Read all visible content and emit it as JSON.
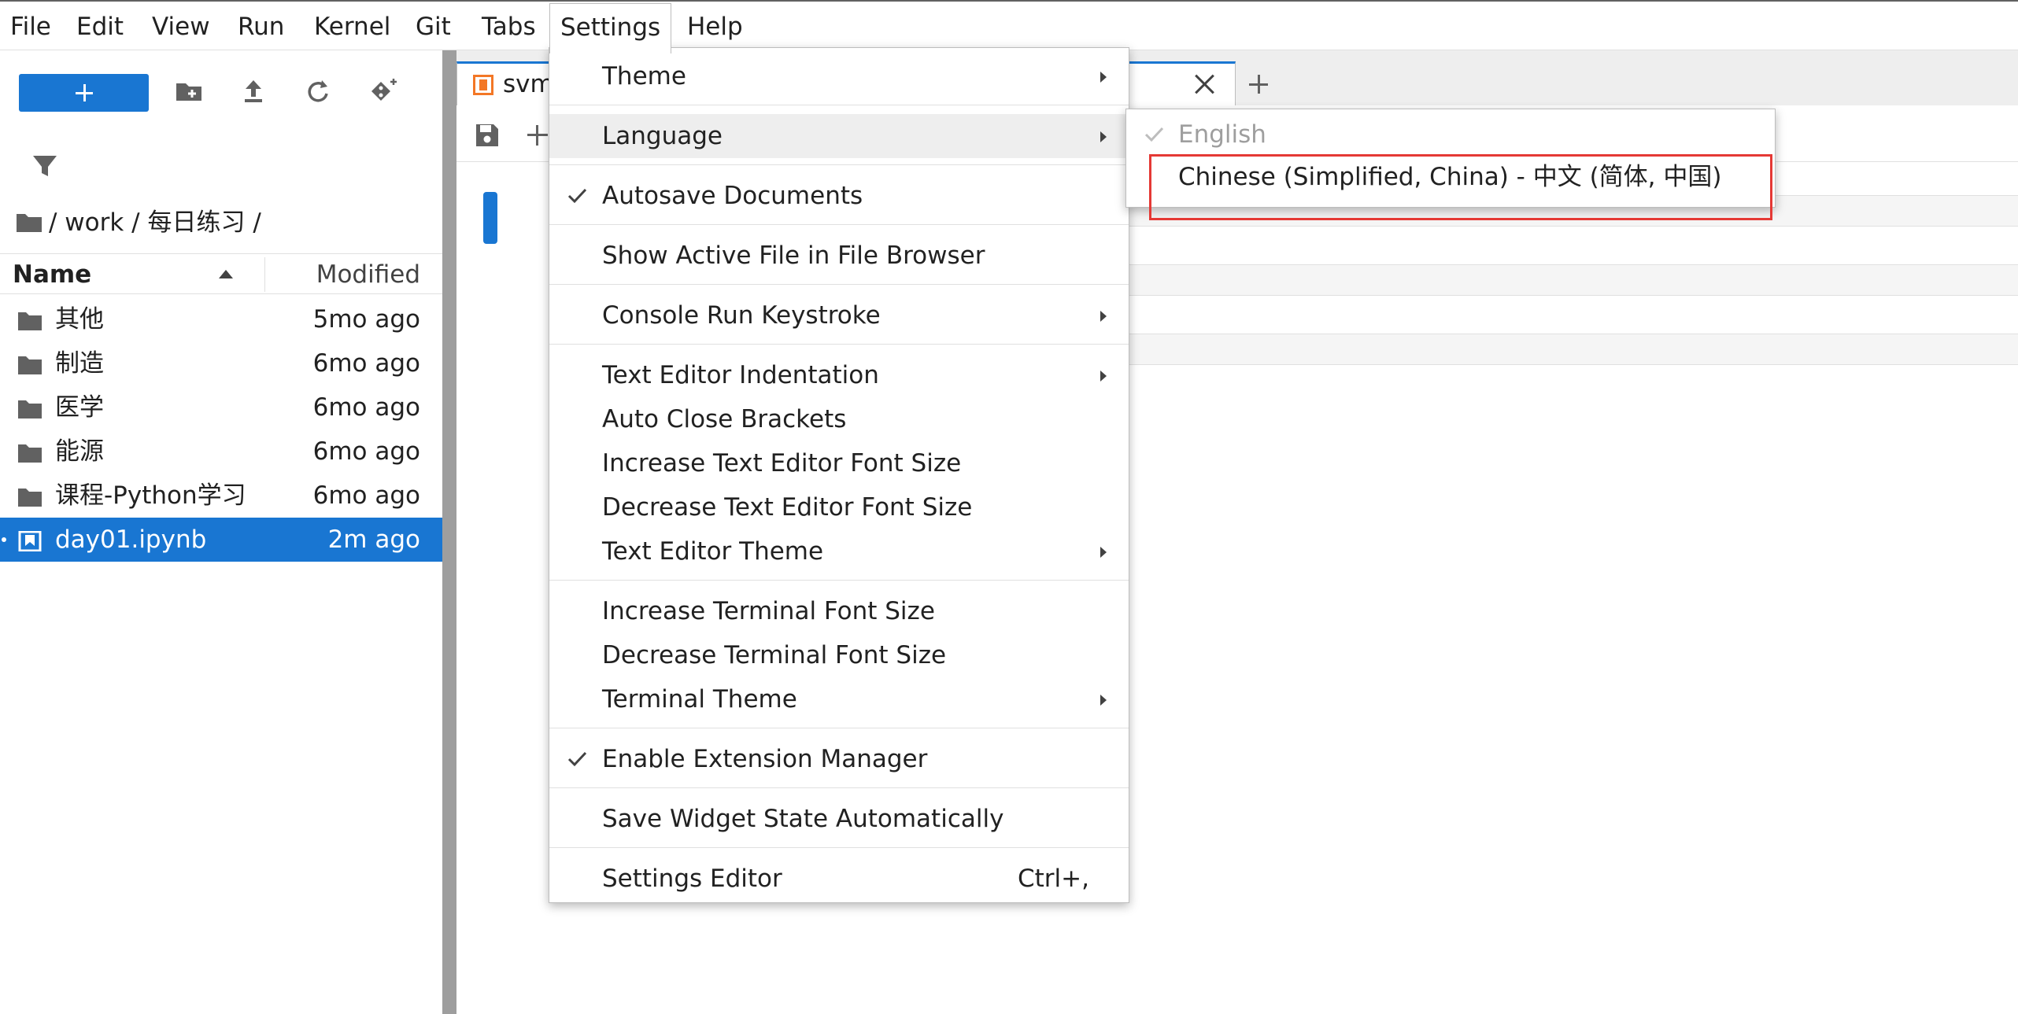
{
  "menubar": {
    "items": [
      "File",
      "Edit",
      "View",
      "Run",
      "Kernel",
      "Git",
      "Tabs",
      "Settings",
      "Help"
    ],
    "active": "Settings"
  },
  "sidebar": {
    "breadcrumb": "/ work / 每日练习 /",
    "columns": {
      "name": "Name",
      "modified": "Modified"
    },
    "files": [
      {
        "name": "其他",
        "modified": "5mo ago",
        "type": "folder"
      },
      {
        "name": "制造",
        "modified": "6mo ago",
        "type": "folder"
      },
      {
        "name": "医学",
        "modified": "6mo ago",
        "type": "folder"
      },
      {
        "name": "能源",
        "modified": "6mo ago",
        "type": "folder"
      },
      {
        "name": "课程-Python学习",
        "modified": "6mo ago",
        "type": "folder"
      },
      {
        "name": "day01.ipynb",
        "modified": "2m ago",
        "type": "notebook",
        "selected": true
      }
    ]
  },
  "tab": {
    "label": "svm"
  },
  "settings_menu": {
    "items": [
      {
        "label": "Theme",
        "submenu": true
      },
      {
        "label": "Language",
        "submenu": true,
        "hovered": true
      },
      {
        "label": "Autosave Documents",
        "checked": true
      },
      {
        "label": "Show Active File in File Browser"
      },
      {
        "label": "Console Run Keystroke",
        "submenu": true
      },
      {
        "label": "Text Editor Indentation",
        "submenu": true
      },
      {
        "label": "Auto Close Brackets"
      },
      {
        "label": "Increase Text Editor Font Size"
      },
      {
        "label": "Decrease Text Editor Font Size"
      },
      {
        "label": "Text Editor Theme",
        "submenu": true
      },
      {
        "label": "Increase Terminal Font Size"
      },
      {
        "label": "Decrease Terminal Font Size"
      },
      {
        "label": "Terminal Theme",
        "submenu": true
      },
      {
        "label": "Enable Extension Manager",
        "checked": true
      },
      {
        "label": "Save Widget State Automatically"
      },
      {
        "label": "Settings Editor",
        "shortcut": "Ctrl+,"
      }
    ]
  },
  "language_menu": {
    "items": [
      {
        "label": "English",
        "checked": true,
        "disabled": true
      },
      {
        "label": "Chinese (Simplified, China) - 中文 (简体, 中国)",
        "highlighted": true
      }
    ]
  },
  "colors": {
    "accent": "#1976d2",
    "highlight_box": "#e53935",
    "notebook_icon": "#f37726"
  },
  "icons": [
    "plus-icon",
    "new-folder-icon",
    "upload-icon",
    "refresh-icon",
    "git-clone-icon",
    "filter-icon",
    "folder-icon",
    "notebook-icon",
    "save-icon",
    "close-icon",
    "check-icon",
    "submenu-arrow-icon"
  ]
}
